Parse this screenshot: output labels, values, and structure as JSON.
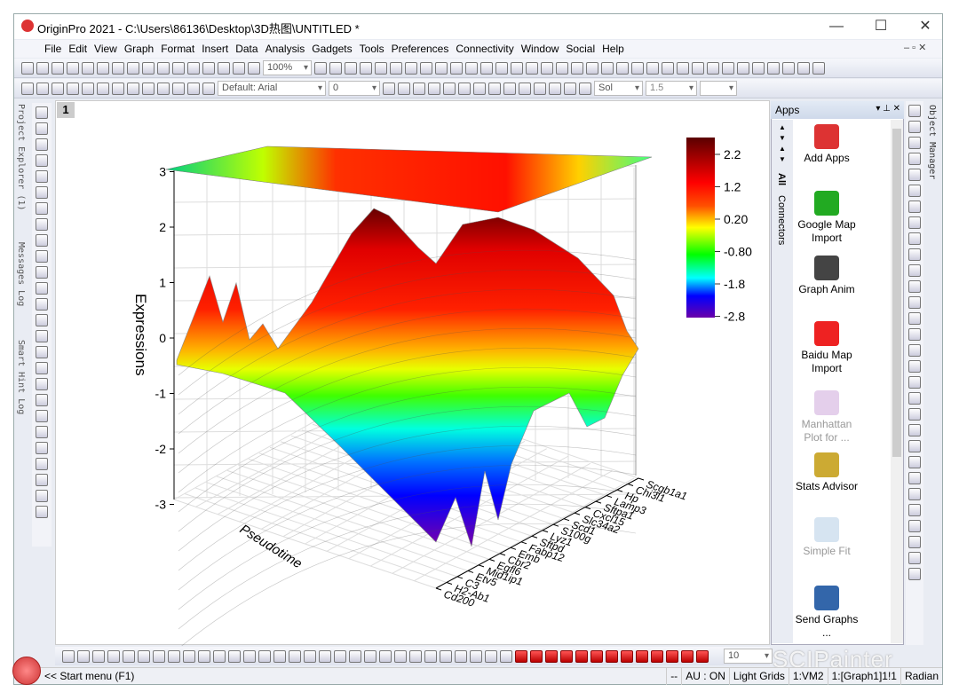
{
  "window": {
    "title": "OriginPro 2021 - C:\\Users\\86136\\Desktop\\3D热图\\UNTITLED *",
    "controls": [
      "minimize",
      "maximize",
      "close"
    ]
  },
  "menu": [
    "File",
    "Edit",
    "View",
    "Graph",
    "Format",
    "Insert",
    "Data",
    "Analysis",
    "Gadgets",
    "Tools",
    "Preferences",
    "Connectivity",
    "Window",
    "Social",
    "Help"
  ],
  "toolbar": {
    "zoom": "100%",
    "font": "Default: Arial",
    "font_size": "0",
    "line_style": "Sol",
    "line_width": "1.5",
    "bottom_value": "10"
  },
  "left_panes": [
    "Project Explorer (1)",
    "Messages Log",
    "Smart Hint Log"
  ],
  "graph": {
    "layer_tag": "1"
  },
  "chart_data": {
    "type": "heatmap",
    "zlabel": "Expressions",
    "xlabel": "Pseudotime",
    "z_ticks": [
      "3",
      "2",
      "1",
      "0",
      "-1",
      "-2",
      "-3"
    ],
    "zlim": [
      -3,
      3
    ],
    "y_categories": [
      "Cd200",
      "H2-Ab1",
      "C3",
      "Etv5",
      "Mid1ip1",
      "Egfl6",
      "Cbr2",
      "Emb",
      "Fabp12",
      "Sftpd",
      "Lyz1",
      "S100g",
      "Scd1",
      "Slc34a2",
      "Cxcl15",
      "Sftpa1",
      "Lamp3",
      "Hp",
      "Chi3l1",
      "Scgb1a1"
    ],
    "colorbar": {
      "ticks": [
        "2.2",
        "1.2",
        "0.20",
        "-0.80",
        "-1.8",
        "-2.8"
      ],
      "colors": [
        "#5a0000",
        "#ff0000",
        "#ffff00",
        "#00ff00",
        "#00ffff",
        "#0000ff",
        "#6a00a8"
      ]
    },
    "grid": true
  },
  "apps_panel": {
    "title": "Apps",
    "tabs": [
      "All",
      "Connectors"
    ],
    "items": [
      {
        "label": "Add Apps",
        "enabled": true
      },
      {
        "label": "Google Map Import",
        "enabled": true
      },
      {
        "label": "Graph Anim",
        "enabled": true
      },
      {
        "label": "Baidu Map Import",
        "enabled": true
      },
      {
        "label": "Manhattan Plot for ...",
        "enabled": false
      },
      {
        "label": "Stats Advisor",
        "enabled": true
      },
      {
        "label": "Simple Fit",
        "enabled": false
      },
      {
        "label": "Send Graphs ...",
        "enabled": true
      }
    ]
  },
  "object_manager": {
    "label": "Object Manager"
  },
  "status": {
    "start": "<< Start menu (F1)",
    "cells": [
      "--",
      "AU : ON",
      "Light Grids",
      "1:VM2",
      "1:[Graph1]1!1",
      "Radian"
    ]
  },
  "watermark": "SCIPainter"
}
